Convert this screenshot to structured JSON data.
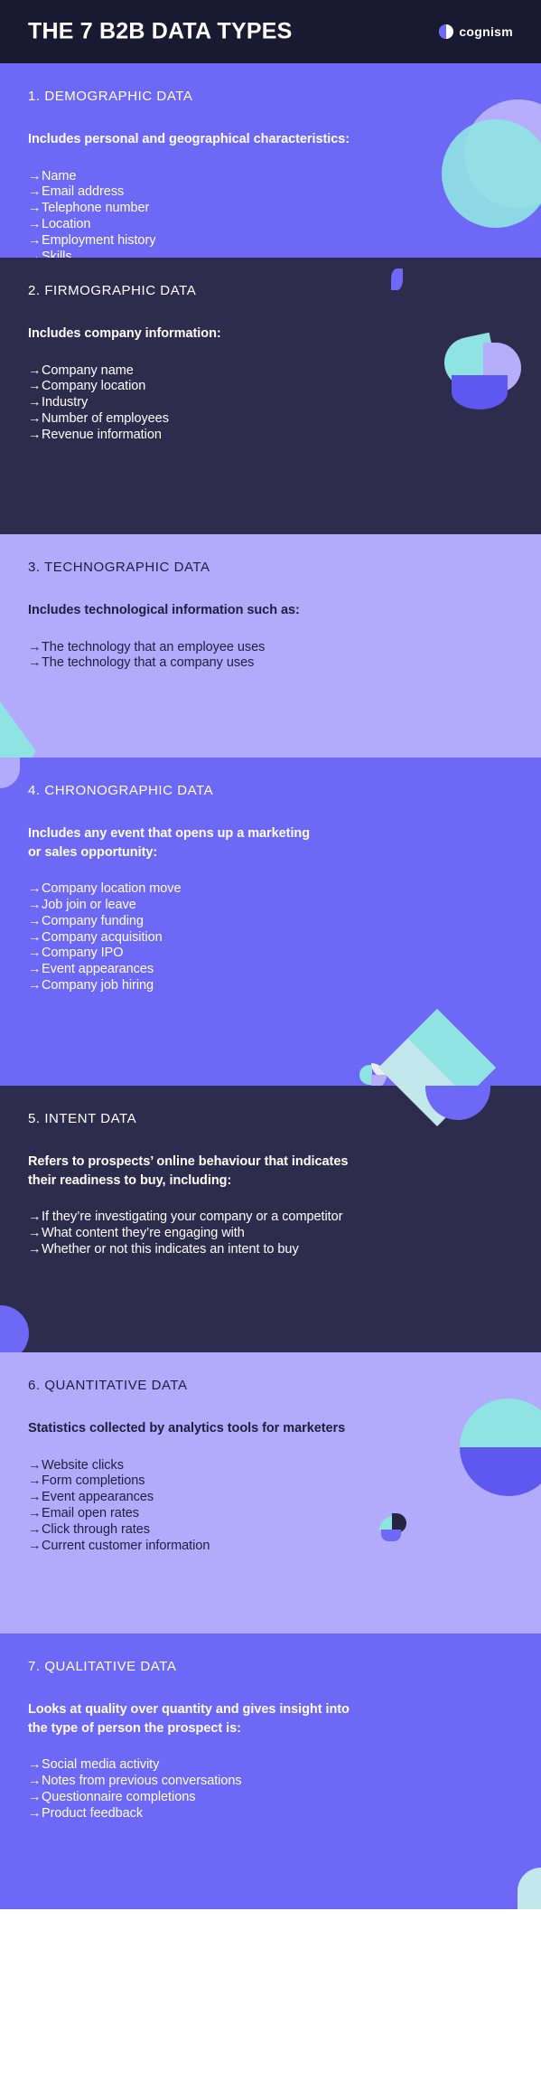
{
  "header": {
    "title": "THE 7 B2B DATA TYPES",
    "logo_text": "cognism",
    "logo_mark": "cognism-circle-mark"
  },
  "palette": {
    "navy_dark": "#191a32",
    "navy": "#2d2c4d",
    "blue": "#6d68f5",
    "lilac": "#b2abfb",
    "cyan": "#8fe3e3",
    "pale_cyan": "#c3e8ec",
    "light_purple": "#b6aefb",
    "text_light": "#ffffff",
    "text_dark": "#1f1f3d"
  },
  "sections": [
    {
      "number": "1.",
      "title": "1. DEMOGRAPHIC DATA",
      "lead": "Includes personal and geographical characteristics:",
      "items": [
        "Name",
        "Email address",
        "Telephone number",
        "Location",
        "Employment history",
        "Skills"
      ]
    },
    {
      "number": "2.",
      "title": "2. FIRMOGRAPHIC DATA",
      "lead": "Includes company information:",
      "items": [
        "Company name",
        "Company location",
        "Industry",
        "Number of employees",
        "Revenue information"
      ]
    },
    {
      "number": "3.",
      "title": "3. TECHNOGRAPHIC DATA",
      "lead": "Includes technological information such as:",
      "items": [
        "The technology that an employee uses",
        "The technology that a company uses"
      ]
    },
    {
      "number": "4.",
      "title": "4. CHRONOGRAPHIC DATA",
      "lead": "Includes any event that opens up a marketing or sales opportunity:",
      "lead_line1": "Includes any event that opens up a marketing",
      "lead_line2": "or sales opportunity:",
      "items": [
        "Company location move",
        "Job join or leave",
        "Company funding",
        "Company acquisition",
        "Company IPO",
        "Event appearances",
        "Company job hiring"
      ]
    },
    {
      "number": "5.",
      "title": "5. INTENT DATA",
      "lead": "Refers to prospects’ online behaviour that indicates their readiness to buy, including:",
      "lead_line1": "Refers to prospects’ online behaviour that indicates",
      "lead_line2": "their readiness to buy, including:",
      "items": [
        "If they’re investigating your company or a competitor",
        "What content they’re engaging with",
        "Whether or not this indicates an intent to buy"
      ]
    },
    {
      "number": "6.",
      "title": "6. QUANTITATIVE DATA",
      "lead": "Statistics collected by analytics tools for marketers",
      "items": [
        "Website clicks",
        "Form completions",
        "Event appearances",
        "Email open rates",
        "Click through rates",
        "Current customer information"
      ]
    },
    {
      "number": "7.",
      "title": "7. QUALITATIVE DATA",
      "lead": "Looks at quality over quantity and gives insight into the type of person the prospect is:",
      "lead_line1": "Looks at quality over quantity and gives insight into",
      "lead_line2": "the type of person the prospect is:",
      "items": [
        "Social media activity",
        "Notes from previous conversations",
        "Questionnaire completions",
        "Product feedback"
      ]
    }
  ],
  "bullet_marker": "→"
}
